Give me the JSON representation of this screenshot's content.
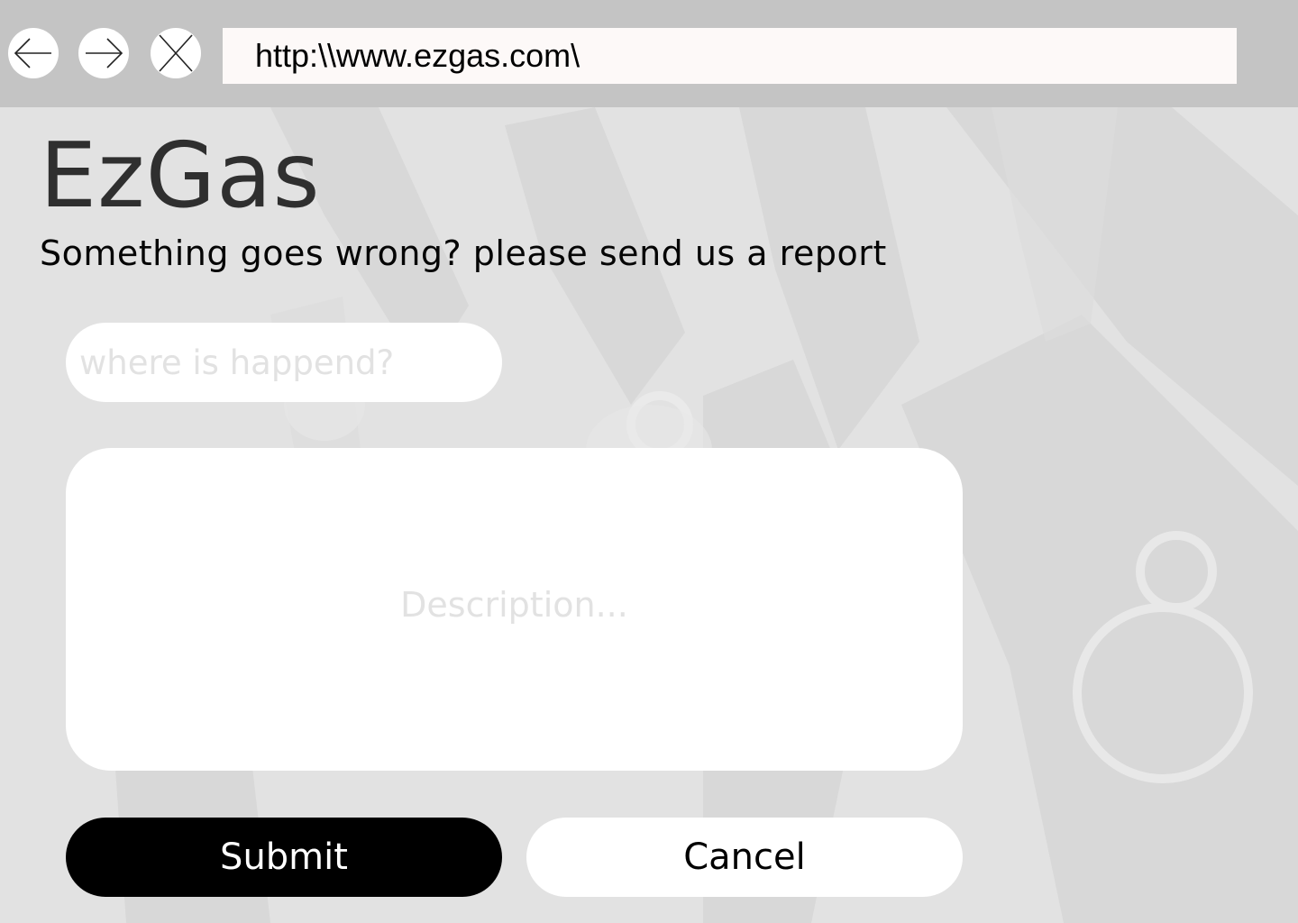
{
  "browser": {
    "url": "http:\\\\www.ezgas.com\\",
    "back_icon": "arrow-left-icon",
    "forward_icon": "arrow-right-icon",
    "close_icon": "close-icon"
  },
  "header": {
    "brand": "EzGas",
    "tagline": "Something goes wrong? please send us a report"
  },
  "form": {
    "location_placeholder": "where is happend?",
    "location_value": "",
    "description_placeholder": "Description...",
    "description_value": "",
    "submit_label": "Submit",
    "cancel_label": "Cancel"
  },
  "colors": {
    "chrome_bar": "#c4c4c4",
    "url_bar": "#fdf9f8",
    "submit_bg": "#000000",
    "cancel_bg": "#ffffff",
    "brand_text": "#2f2f2f",
    "placeholder_text": "#e2e2e2"
  }
}
